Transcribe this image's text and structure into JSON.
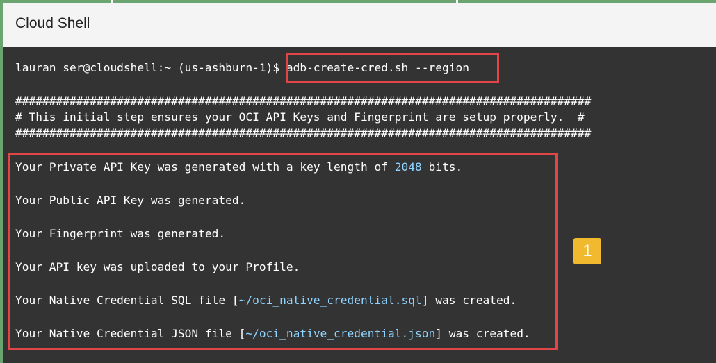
{
  "header": {
    "title": "Cloud Shell"
  },
  "terminal": {
    "prompt": "lauran_ser@cloudshell:~ (us-ashburn-1)$ ",
    "command": "adb-create-cred.sh --region",
    "banner": [
      "#####################################################################################",
      "# This initial step ensures your OCI API Keys and Fingerprint are setup properly.  #",
      "#####################################################################################"
    ],
    "output": {
      "private_key_pre": "Your Private API Key was generated with a key length of ",
      "private_key_len": "2048",
      "private_key_post": " bits.",
      "public_key": "Your Public API Key was generated.",
      "fingerprint": "Your Fingerprint was generated.",
      "uploaded": "Your API key was uploaded to your Profile.",
      "sql_pre": "Your Native Credential SQL file [",
      "sql_path": "~/oci_native_credential.sql",
      "sql_post": "] was created.",
      "json_pre": "Your Native Credential JSON file [",
      "json_path": "~/oci_native_credential.json",
      "json_post": "] was created."
    }
  },
  "annotations": {
    "step_badge": "1",
    "highlight_color": "#e04646",
    "badge_color": "#f0b92e"
  },
  "colors": {
    "terminal_bg": "#333333",
    "accent_green": "#6aa56f",
    "number_highlight": "#8fd3ff"
  }
}
